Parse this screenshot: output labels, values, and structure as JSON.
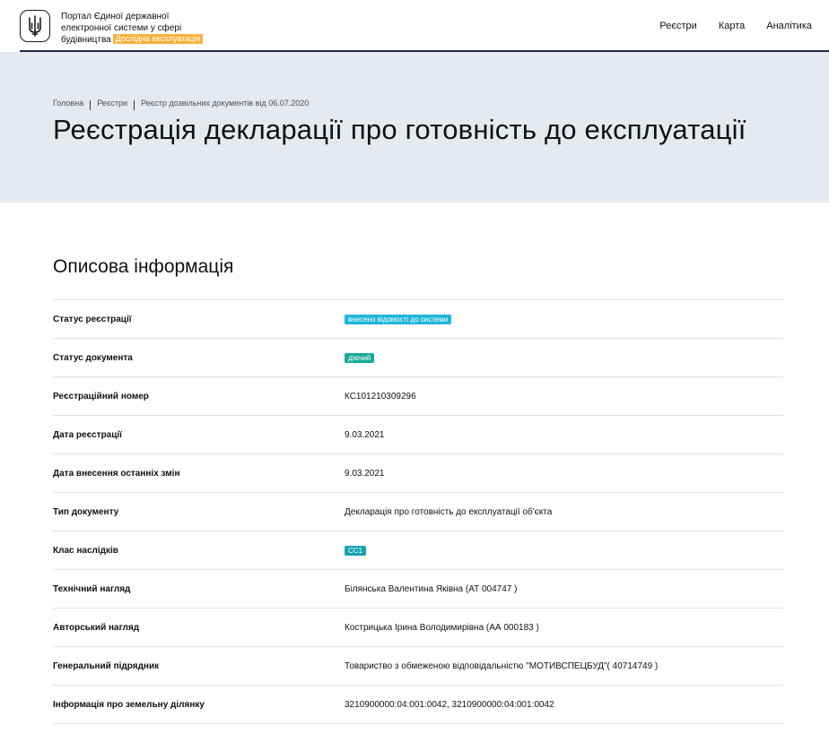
{
  "header": {
    "portal_title_lines": [
      "Портал Єдиної державної",
      "електронної системи у сфері",
      "будівництва"
    ],
    "beta_badge": "Дослідна експлуатація",
    "nav": [
      "Реєстри",
      "Карта",
      "Аналітика"
    ]
  },
  "breadcrumb": [
    "Головна",
    "Реєстри",
    "Реєстр дозвільних документів від 06.07.2020"
  ],
  "page_title": "Реєстрація декларації про готовність до експлуатації",
  "section_title": "Описова інформація",
  "rows": [
    {
      "label": "Статус реєстрації",
      "value": "внесено відомості до системи",
      "tag_color": "#1fb6d8"
    },
    {
      "label": "Статус документа",
      "value": "діючий",
      "tag_color": "#1aa89a"
    },
    {
      "label": "Реєстраційний номер",
      "value": "КС101210309296"
    },
    {
      "label": "Дата реєстрації",
      "value": "9.03.2021"
    },
    {
      "label": "Дата внесення останніх змін",
      "value": "9.03.2021"
    },
    {
      "label": "Тип документу",
      "value": "Декларація про готовність до експлуатації об'єкта"
    },
    {
      "label": "Клас наслідків",
      "value": "СС1",
      "tag_color": "#1aa0b0"
    },
    {
      "label": "Технічний нагляд",
      "value": "Білянська Валентина Яківна (АТ 004747 )"
    },
    {
      "label": "Авторський нагляд",
      "value": "Кострицька Ірина Володимирівна (АА 000183 )"
    },
    {
      "label": "Генеральний підрядник",
      "value": "Товариство з обмеженою відповідальністю \"МОТИВСПЕЦБУД\"( 40714749 )"
    },
    {
      "label": "Інформація про земельну ділянку",
      "value": "3210900000:04:001:0042, 3210900000:04:001:0042"
    }
  ],
  "colors": {
    "hero_bg": "#e5eaf1",
    "beta_badge": "#f6b13a",
    "header_line": "#1f2a44"
  }
}
